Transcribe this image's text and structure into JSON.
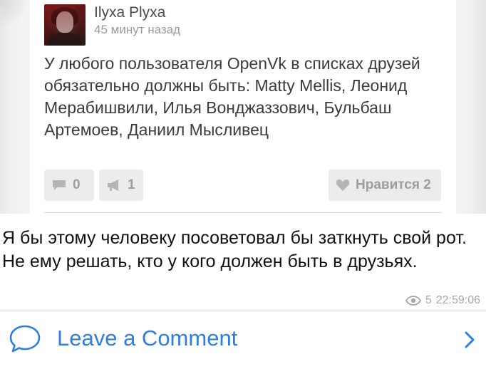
{
  "post": {
    "author": "Ilyxa Plyxa",
    "time": "45 минут назад",
    "text": "У любого пользователя OpenVk в списках друзей обязательно должны быть: Matty Mellis, Леонид Мерабишвили, Илья Вонджаззович, Бульбаш Артемоев, Даниил Мысливец",
    "comments_count": "0",
    "reposts_count": "1",
    "likes_label": "Нравится 2"
  },
  "message": {
    "text": "Я бы этому человеку посоветовал бы заткнуть свой рот. Не ему решать, кто у кого должен быть в друзьях.",
    "views": "5",
    "time": "22:59:06"
  },
  "footer": {
    "leave_comment_label": "Leave a Comment"
  },
  "colors": {
    "accent": "#2f7de1",
    "meta": "#a7a7a7",
    "pill_bg": "#ececec"
  },
  "icons": {
    "comment": "speech-bubble-icon",
    "repost": "megaphone-icon",
    "like": "heart-icon",
    "views": "eye-icon",
    "chevron": "chevron-right-icon"
  }
}
